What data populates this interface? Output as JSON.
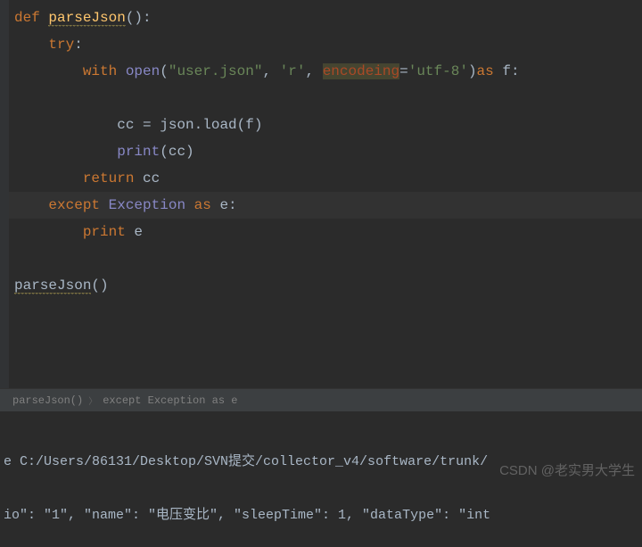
{
  "code": {
    "line1_def": "def ",
    "line1_fn": "parseJson",
    "line1_end": "():",
    "line2_try": "    try",
    "line2_colon": ":",
    "line3_with": "        with ",
    "line3_open": "open",
    "line3_p1": "(",
    "line3_str1": "\"user.json\"",
    "line3_c1": ", ",
    "line3_str2": "'r'",
    "line3_c2": ", ",
    "line3_param": "encodeing",
    "line3_eq": "=",
    "line3_str3": "'utf-8'",
    "line3_p2": ")",
    "line3_as": "as ",
    "line3_f": "f:",
    "line5_pre": "            cc = json.load(f)",
    "line5_cc": "            cc ",
    "line5_eq": "= ",
    "line5_json": "json.load",
    "line5_p": "(f)",
    "line6_print": "            print",
    "line6_cc": "(cc)",
    "line7_return": "        return ",
    "line7_cc": "cc",
    "line8_except": "    except ",
    "line8_exc": "Exception ",
    "line8_as": "as ",
    "line8_e": "e:",
    "line9_print": "        print ",
    "line9_e": "e",
    "line11_call": "parseJson",
    "line11_p": "()"
  },
  "breadcrumb": {
    "item1": "parseJson()",
    "item2": "except Exception as e"
  },
  "console": {
    "line1": "e C:/Users/86131/Desktop/SVN提交/collector_v4/software/trunk/",
    "line2": "io\": \"1\", \"name\": \"电压变比\", \"sleepTime\": 1, \"dataType\": \"int"
  },
  "watermark": "CSDN @老实男大学生"
}
